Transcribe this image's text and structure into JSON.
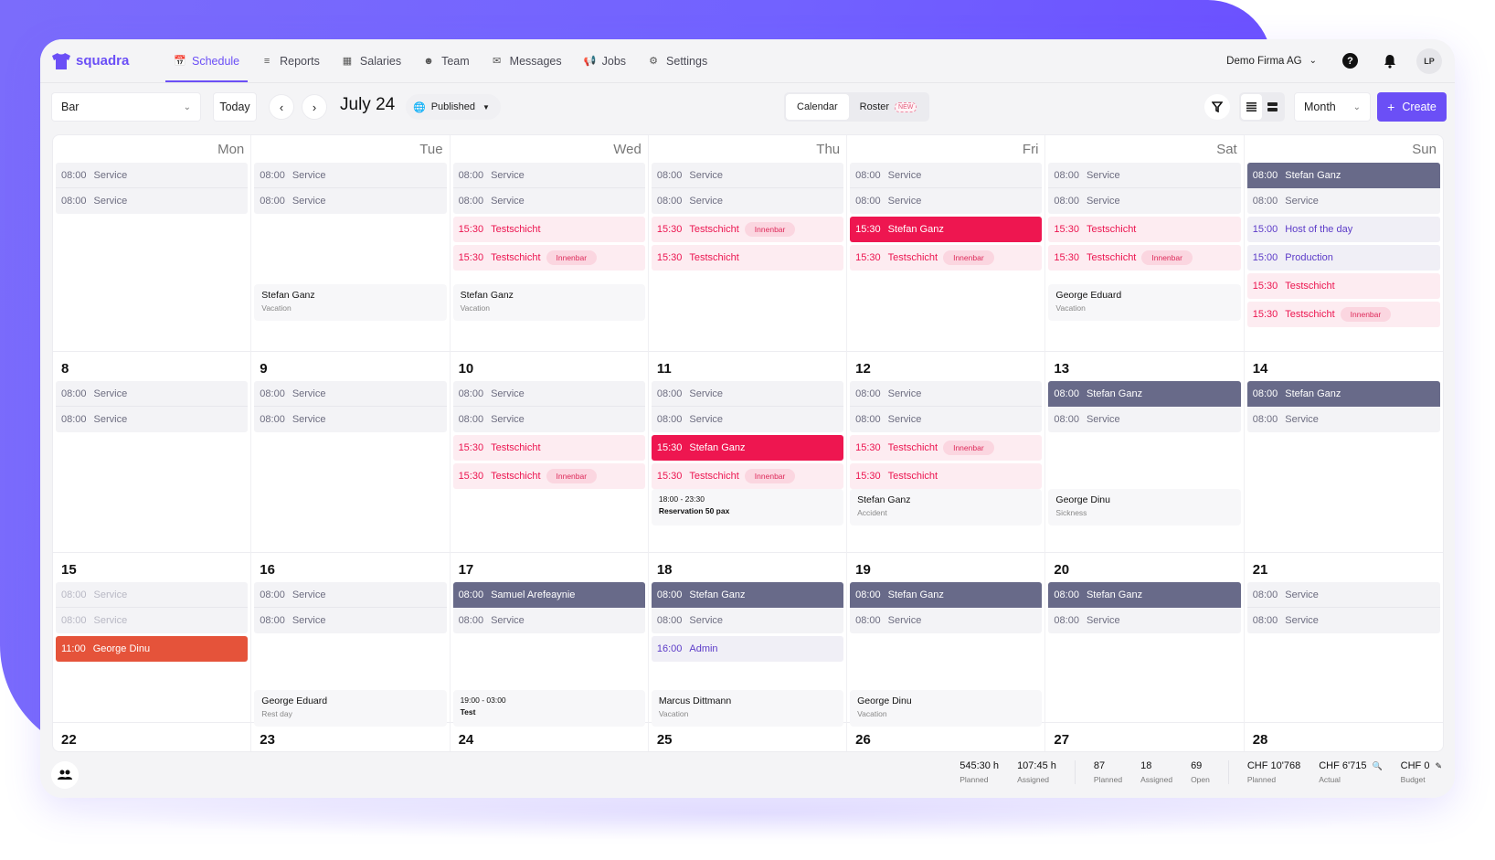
{
  "app": {
    "brand": "squadra",
    "brand_color": "#6b4ff6"
  },
  "nav": {
    "items": [
      {
        "label": "Schedule",
        "icon": "calendar-icon",
        "active": true
      },
      {
        "label": "Reports",
        "icon": "list-icon"
      },
      {
        "label": "Salaries",
        "icon": "table-icon"
      },
      {
        "label": "Team",
        "icon": "people-icon"
      },
      {
        "label": "Messages",
        "icon": "mail-icon"
      },
      {
        "label": "Jobs",
        "icon": "megaphone-icon"
      },
      {
        "label": "Settings",
        "icon": "gear-icon"
      }
    ],
    "company": "Demo Firma AG",
    "avatar_initials": "LP"
  },
  "toolbar": {
    "location_select": "Bar",
    "today_label": "Today",
    "period_label": "July 24",
    "status_label": "Published",
    "view_calendar": "Calendar",
    "view_roster": "Roster",
    "roster_badge": "NEW",
    "range_select": "Month",
    "create_label": "Create"
  },
  "calendar": {
    "weekdays": [
      "Mon",
      "Tue",
      "Wed",
      "Thu",
      "Fri",
      "Sat",
      "Sun"
    ],
    "weeks": [
      {
        "days": [
          {
            "label": "",
            "shifts": [
              {
                "time": "08:00",
                "title": "Service",
                "style": "grey"
              },
              {
                "time": "08:00",
                "title": "Service",
                "style": "grey"
              }
            ]
          },
          {
            "label": "",
            "shifts": [
              {
                "time": "08:00",
                "title": "Service",
                "style": "grey"
              },
              {
                "time": "08:00",
                "title": "Service",
                "style": "grey"
              }
            ],
            "absence": {
              "name": "Stefan Ganz",
              "reason": "Vacation"
            }
          },
          {
            "label": "",
            "shifts": [
              {
                "time": "08:00",
                "title": "Service",
                "style": "grey"
              },
              {
                "time": "08:00",
                "title": "Service",
                "style": "grey"
              },
              {
                "time": "15:30",
                "title": "Testschicht",
                "style": "pink"
              },
              {
                "time": "15:30",
                "title": "Testschicht",
                "style": "pink",
                "badge": "Innenbar"
              }
            ],
            "absence": {
              "name": "Stefan Ganz",
              "reason": "Vacation"
            }
          },
          {
            "label": "",
            "shifts": [
              {
                "time": "08:00",
                "title": "Service",
                "style": "grey"
              },
              {
                "time": "08:00",
                "title": "Service",
                "style": "grey"
              },
              {
                "time": "15:30",
                "title": "Testschicht",
                "style": "pink",
                "badge": "Innenbar"
              },
              {
                "time": "15:30",
                "title": "Testschicht",
                "style": "pink"
              }
            ]
          },
          {
            "label": "",
            "shifts": [
              {
                "time": "08:00",
                "title": "Service",
                "style": "grey"
              },
              {
                "time": "08:00",
                "title": "Service",
                "style": "grey"
              },
              {
                "time": "15:30",
                "title": "Stefan Ganz",
                "style": "red"
              },
              {
                "time": "15:30",
                "title": "Testschicht",
                "style": "pink",
                "badge": "Innenbar"
              }
            ]
          },
          {
            "label": "",
            "shifts": [
              {
                "time": "08:00",
                "title": "Service",
                "style": "grey"
              },
              {
                "time": "08:00",
                "title": "Service",
                "style": "grey"
              },
              {
                "time": "15:30",
                "title": "Testschicht",
                "style": "pink"
              },
              {
                "time": "15:30",
                "title": "Testschicht",
                "style": "pink",
                "badge": "Innenbar"
              }
            ],
            "absence": {
              "name": "George Eduard",
              "reason": "Vacation"
            }
          },
          {
            "label": "",
            "shifts": [
              {
                "time": "08:00",
                "title": "Stefan Ganz",
                "style": "dark"
              },
              {
                "time": "08:00",
                "title": "Service",
                "style": "grey"
              },
              {
                "time": "15:00",
                "title": "Host of the day",
                "style": "purple"
              },
              {
                "time": "15:00",
                "title": "Production",
                "style": "purple"
              },
              {
                "time": "15:30",
                "title": "Testschicht",
                "style": "pink"
              },
              {
                "time": "15:30",
                "title": "Testschicht",
                "style": "pink",
                "badge": "Innenbar"
              }
            ]
          }
        ]
      },
      {
        "days": [
          {
            "label": "8",
            "shifts": [
              {
                "time": "08:00",
                "title": "Service",
                "style": "grey"
              },
              {
                "time": "08:00",
                "title": "Service",
                "style": "grey"
              }
            ]
          },
          {
            "label": "9",
            "shifts": [
              {
                "time": "08:00",
                "title": "Service",
                "style": "grey"
              },
              {
                "time": "08:00",
                "title": "Service",
                "style": "grey"
              }
            ]
          },
          {
            "label": "10",
            "shifts": [
              {
                "time": "08:00",
                "title": "Service",
                "style": "grey"
              },
              {
                "time": "08:00",
                "title": "Service",
                "style": "grey"
              },
              {
                "time": "15:30",
                "title": "Testschicht",
                "style": "pink"
              },
              {
                "time": "15:30",
                "title": "Testschicht",
                "style": "pink",
                "badge": "Innenbar"
              }
            ]
          },
          {
            "label": "11",
            "shifts": [
              {
                "time": "08:00",
                "title": "Service",
                "style": "grey"
              },
              {
                "time": "08:00",
                "title": "Service",
                "style": "grey"
              },
              {
                "time": "15:30",
                "title": "Stefan Ganz",
                "style": "red"
              },
              {
                "time": "15:30",
                "title": "Testschicht",
                "style": "pink",
                "badge": "Innenbar"
              }
            ],
            "event": {
              "time": "18:00 - 23:30",
              "title": "Reservation 50 pax"
            }
          },
          {
            "label": "12",
            "shifts": [
              {
                "time": "08:00",
                "title": "Service",
                "style": "grey"
              },
              {
                "time": "08:00",
                "title": "Service",
                "style": "grey"
              },
              {
                "time": "15:30",
                "title": "Testschicht",
                "style": "pink",
                "badge": "Innenbar"
              },
              {
                "time": "15:30",
                "title": "Testschicht",
                "style": "pink"
              }
            ],
            "absence": {
              "name": "Stefan Ganz",
              "reason": "Accident"
            }
          },
          {
            "label": "13",
            "shifts": [
              {
                "time": "08:00",
                "title": "Stefan Ganz",
                "style": "dark"
              },
              {
                "time": "08:00",
                "title": "Service",
                "style": "grey"
              }
            ],
            "absence": {
              "name": "George Dinu",
              "reason": "Sickness"
            }
          },
          {
            "label": "14",
            "shifts": [
              {
                "time": "08:00",
                "title": "Stefan Ganz",
                "style": "dark"
              },
              {
                "time": "08:00",
                "title": "Service",
                "style": "grey"
              }
            ]
          }
        ]
      },
      {
        "days": [
          {
            "label": "15",
            "shifts": [
              {
                "time": "08:00",
                "title": "Service",
                "style": "faded"
              },
              {
                "time": "08:00",
                "title": "Service",
                "style": "faded"
              },
              {
                "time": "11:00",
                "title": "George Dinu",
                "style": "orange"
              }
            ]
          },
          {
            "label": "16",
            "shifts": [
              {
                "time": "08:00",
                "title": "Service",
                "style": "grey"
              },
              {
                "time": "08:00",
                "title": "Service",
                "style": "grey"
              }
            ],
            "absence": {
              "name": "George Eduard",
              "reason": "Rest day"
            }
          },
          {
            "label": "17",
            "shifts": [
              {
                "time": "08:00",
                "title": "Samuel Arefeaynie",
                "style": "dark"
              },
              {
                "time": "08:00",
                "title": "Service",
                "style": "grey"
              }
            ],
            "event": {
              "time": "19:00 - 03:00",
              "title": "Test"
            }
          },
          {
            "label": "18",
            "shifts": [
              {
                "time": "08:00",
                "title": "Stefan Ganz",
                "style": "dark"
              },
              {
                "time": "08:00",
                "title": "Service",
                "style": "grey"
              },
              {
                "time": "16:00",
                "title": "Admin",
                "style": "purple"
              }
            ],
            "absence": {
              "name": "Marcus Dittmann",
              "reason": "Vacation"
            }
          },
          {
            "label": "19",
            "shifts": [
              {
                "time": "08:00",
                "title": "Stefan Ganz",
                "style": "dark"
              },
              {
                "time": "08:00",
                "title": "Service",
                "style": "grey"
              }
            ],
            "absence": {
              "name": "George Dinu",
              "reason": "Vacation"
            }
          },
          {
            "label": "20",
            "shifts": [
              {
                "time": "08:00",
                "title": "Stefan Ganz",
                "style": "dark"
              },
              {
                "time": "08:00",
                "title": "Service",
                "style": "grey"
              }
            ]
          },
          {
            "label": "21",
            "shifts": [
              {
                "time": "08:00",
                "title": "Service",
                "style": "grey"
              },
              {
                "time": "08:00",
                "title": "Service",
                "style": "grey"
              }
            ]
          }
        ]
      },
      {
        "days": [
          {
            "label": "22",
            "shifts": []
          },
          {
            "label": "23",
            "shifts": []
          },
          {
            "label": "24",
            "shifts": []
          },
          {
            "label": "25",
            "shifts": []
          },
          {
            "label": "26",
            "shifts": []
          },
          {
            "label": "27",
            "shifts": []
          },
          {
            "label": "28",
            "shifts": []
          }
        ]
      }
    ]
  },
  "footer": {
    "stats_groups": [
      [
        {
          "value": "545:30 h",
          "label": "Planned"
        },
        {
          "value": "107:45 h",
          "label": "Assigned"
        }
      ],
      [
        {
          "value": "87",
          "label": "Planned"
        },
        {
          "value": "18",
          "label": "Assigned"
        },
        {
          "value": "69",
          "label": "Open"
        }
      ],
      [
        {
          "value": "CHF 10'768",
          "label": "Planned"
        },
        {
          "value": "CHF 6'715",
          "label": "Actual",
          "icon": "search-icon"
        },
        {
          "value": "CHF 0",
          "label": "Budget",
          "icon": "pencil-icon"
        }
      ]
    ]
  },
  "colors": {
    "accent": "#6b4ff6",
    "shift_grey": "#f3f3f6",
    "shift_dark": "#686a89",
    "shift_pink": "#fdecf1",
    "shift_red": "#ee1650",
    "shift_orange": "#e5533a",
    "shift_purple_text": "#5c3bc8"
  }
}
